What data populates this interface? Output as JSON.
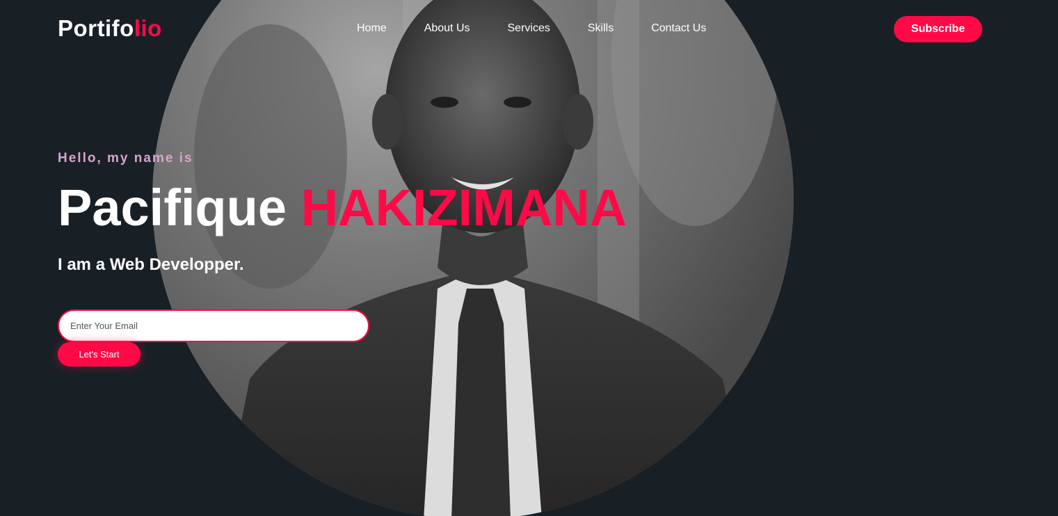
{
  "header": {
    "logo_main": "Portifo",
    "logo_accent": "lio",
    "nav": [
      "Home",
      "About Us",
      "Services",
      "Skills",
      "Contact Us"
    ],
    "subscribe_label": "Subscribe"
  },
  "hero": {
    "greeting": "Hello, my name is",
    "first_name": "Pacifique",
    "last_name": "HAKIZIMANA",
    "role": "I am a Web Developper.",
    "email_placeholder": "Enter Your Email",
    "email_value": "",
    "cta_label": "Let's Start"
  },
  "colors": {
    "background": "#182026",
    "accent": "#ff0a47",
    "greeting": "#d9a3cf",
    "text": "#ffffff"
  },
  "image": {
    "subject": "portrait-photo",
    "style": "black-and-white"
  }
}
